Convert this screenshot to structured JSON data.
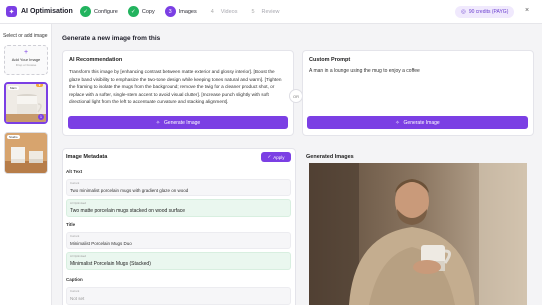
{
  "app": {
    "title": "AI Optimisation",
    "close": "×"
  },
  "steps": [
    {
      "label": "Configure",
      "state": "done",
      "marker": "✓"
    },
    {
      "label": "Copy",
      "state": "done",
      "marker": "✓"
    },
    {
      "label": "Images",
      "state": "active",
      "marker": "3"
    },
    {
      "label": "Videos",
      "state": "todo",
      "marker": "4"
    },
    {
      "label": "Review",
      "state": "todo",
      "marker": "5"
    }
  ],
  "credits": {
    "label": "90 credits (PAYG)"
  },
  "sidebar": {
    "title": "Select or add image",
    "add": {
      "icon": "+",
      "label": "Add Your Image",
      "sub": "Drop or browse"
    },
    "thumbs": [
      {
        "tag": "Main",
        "badge": "",
        "number": "1"
      },
      {
        "tag": "Studio",
        "badge": "",
        "number": ""
      }
    ]
  },
  "main": {
    "heading": "Generate a new image from this",
    "recommendation": {
      "title": "AI Recommendation",
      "text": "Transform this image by [enhancing contrast between matte exterior and glossy interior]. [Boost the glaze band visibility to emphasize the two-tone design while keeping tones natural and warm]. [Tighten the framing to isolate the mugs from the background; remove the twig for a cleaner product shot, or replace with a softer, single-stem accent to avoid visual clutter]. [Increase punch slightly with soft directional light from the left to accentuate curvature and stacking alignment].",
      "button": "Generate Image"
    },
    "or_label": "OR",
    "custom": {
      "title": "Custom Prompt",
      "text": "A man in a lounge using the mug to enjoy a coffee",
      "button": "Generate Image"
    }
  },
  "metadata": {
    "title": "Image Metadata",
    "apply": "Apply",
    "fields": [
      {
        "label": "Alt Text",
        "current_tag": "Current",
        "current": "Two minimalist porcelain mugs with gradient glaze on wood",
        "optimised_tag": "AI Optimised",
        "optimised": "Two matte porcelain mugs stacked on wood surface"
      },
      {
        "label": "Title",
        "current_tag": "Current",
        "current": "Minimalist Porcelain Mugs Duo",
        "optimised_tag": "AI Optimised",
        "optimised": "Minimalist Porcelain Mugs (Stacked)"
      },
      {
        "label": "Caption",
        "current_tag": "Current",
        "current": "Not set"
      }
    ]
  },
  "generated": {
    "title": "Generated Images"
  }
}
